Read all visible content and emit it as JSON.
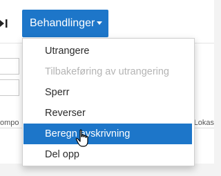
{
  "toolbar": {
    "behandlinger_label": "Behandlinger"
  },
  "menu": {
    "items": [
      {
        "label": "Utrangere",
        "state": "normal"
      },
      {
        "label": "Tilbakeføring av utrangering",
        "state": "disabled"
      },
      {
        "label": "Sperr",
        "state": "normal"
      },
      {
        "label": "Reverser",
        "state": "normal"
      },
      {
        "label": "Beregn avskrivning",
        "state": "hover"
      },
      {
        "label": "Del opp",
        "state": "normal"
      }
    ]
  },
  "background": {
    "column_left_partial": "ompo",
    "column_right_partial": "Lokas"
  },
  "colors": {
    "accent": "#1d76c9",
    "disabled_text": "#b4b4b4"
  },
  "icons": {
    "pagination": "last-page-icon",
    "dropdown": "caret-down-icon",
    "pointer": "hand-cursor-icon"
  }
}
